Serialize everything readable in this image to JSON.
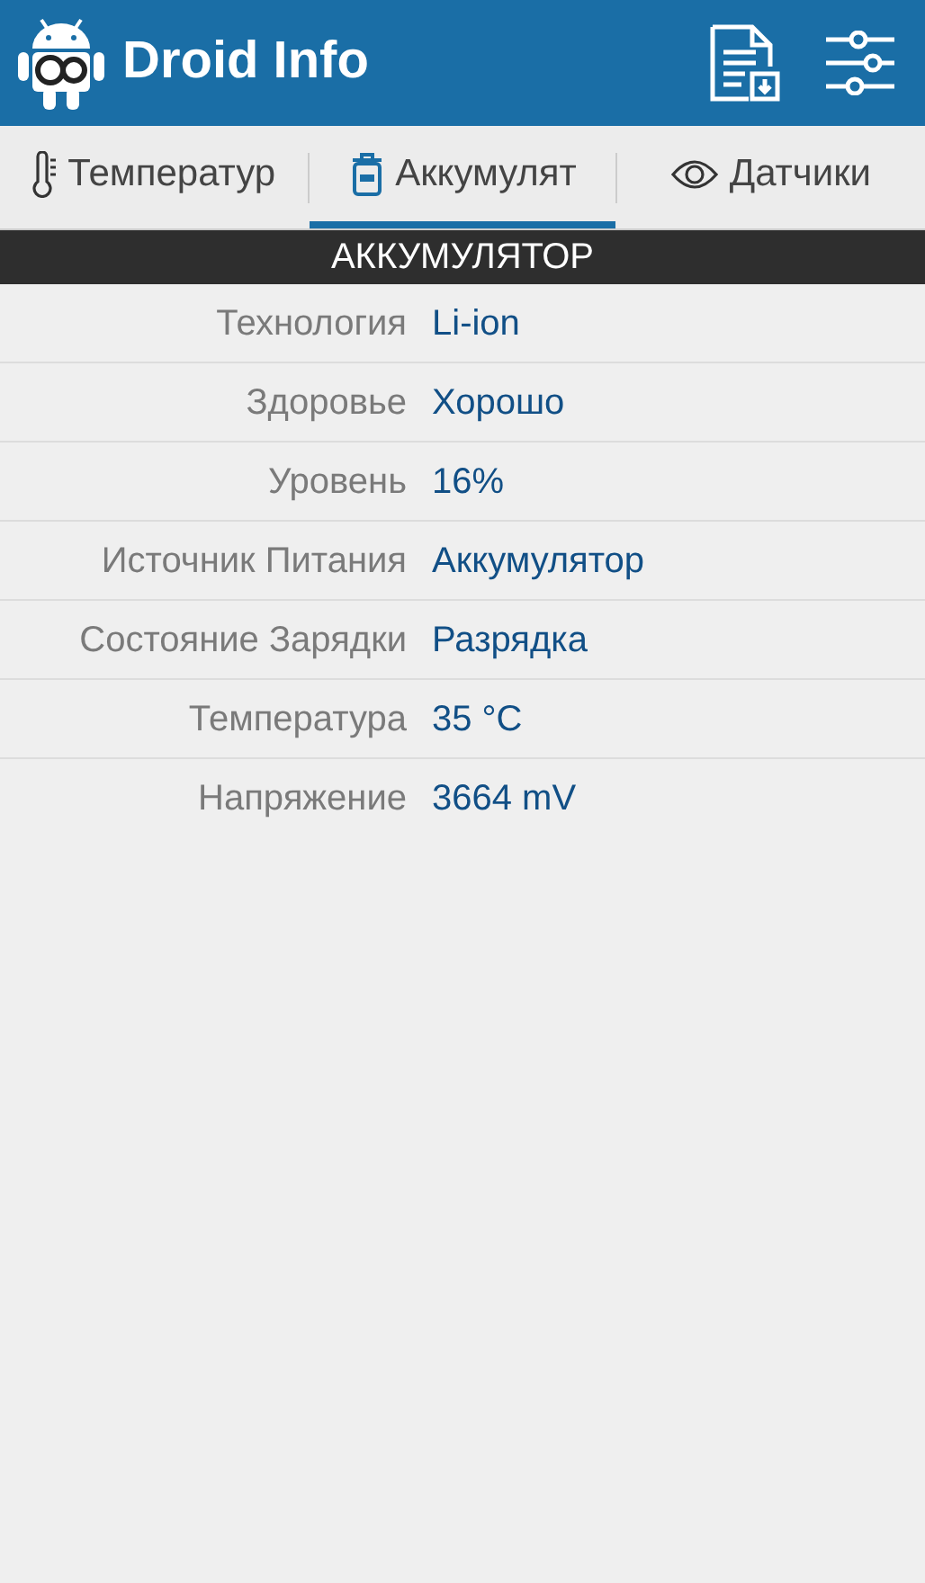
{
  "app_bar": {
    "title": "Droid Info"
  },
  "tabs": [
    {
      "label": "Температур",
      "kind": "thermometer",
      "selected": false
    },
    {
      "label": "Аккумулят",
      "kind": "battery",
      "selected": true
    },
    {
      "label": "Датчики",
      "kind": "eye",
      "selected": false
    }
  ],
  "section": {
    "title": "АККУМУЛЯТОР"
  },
  "rows": [
    {
      "label": "Технология",
      "value": "Li-ion"
    },
    {
      "label": "Здоровье",
      "value": "Хорошо"
    },
    {
      "label": "Уровень",
      "value": "16%"
    },
    {
      "label": "Источник Питания",
      "value": "Аккумулятор"
    },
    {
      "label": "Состояние Зарядки",
      "value": "Разрядка"
    },
    {
      "label": "Температура",
      "value": "35 °C"
    },
    {
      "label": "Напряжение",
      "value": "3664 mV"
    }
  ]
}
